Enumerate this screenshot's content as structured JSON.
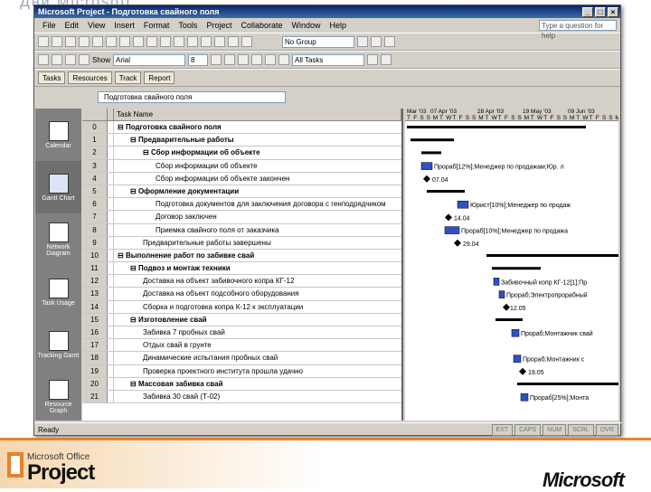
{
  "slide_title": "Дни Microsoft",
  "window": {
    "title": "Microsoft Project - Подготовка свайного поля",
    "min": "_",
    "max": "□",
    "close": "×"
  },
  "menu": [
    "File",
    "Edit",
    "View",
    "Insert",
    "Format",
    "Tools",
    "Project",
    "Collaborate",
    "Window",
    "Help"
  ],
  "ask_placeholder": "Type a question for help",
  "toolbar1": {
    "group_combo": "No Group"
  },
  "toolbar2": {
    "show_label": "Show",
    "font": "Arial",
    "size": "8",
    "filter": "All Tasks"
  },
  "toolbar3": [
    "Tasks",
    "Resources",
    "Track",
    "Report"
  ],
  "entry_value": "Подготовка свайного поля",
  "viewbar": [
    "Calendar",
    "Gantt Chart",
    "Network Diagram",
    "Task Usage",
    "Tracking Gantt",
    "Resource Graph"
  ],
  "grid": {
    "header_name": "Task Name",
    "rows": [
      {
        "id": "0",
        "name": "Подготовка свайного поля",
        "level": 0,
        "summary": true
      },
      {
        "id": "1",
        "name": "Предварительные работы",
        "level": 1,
        "summary": true
      },
      {
        "id": "2",
        "name": "Сбор информации об объекте",
        "level": 2,
        "summary": true
      },
      {
        "id": "3",
        "name": "Сбор информации об объекте",
        "level": 3,
        "summary": false
      },
      {
        "id": "4",
        "name": "Сбор информации об объекте закончен",
        "level": 3,
        "summary": false
      },
      {
        "id": "5",
        "name": "Оформление документации",
        "level": 1,
        "summary": true
      },
      {
        "id": "6",
        "name": "Подготовка документов для заключения договора с генподрядчиком",
        "level": 3,
        "summary": false
      },
      {
        "id": "7",
        "name": "Договор заключен",
        "level": 3,
        "summary": false
      },
      {
        "id": "8",
        "name": "Приемка свайного поля от заказчика",
        "level": 3,
        "summary": false
      },
      {
        "id": "9",
        "name": "Предварительные работы завершены",
        "level": 2,
        "summary": false
      },
      {
        "id": "10",
        "name": "Выполнение работ по забивке свай",
        "level": 0,
        "summary": true
      },
      {
        "id": "11",
        "name": "Подвоз и монтаж техники",
        "level": 1,
        "summary": true
      },
      {
        "id": "12",
        "name": "Доставка на объект забивочного копра КГ-12",
        "level": 2,
        "summary": false
      },
      {
        "id": "13",
        "name": "Доставка на объект подсобного оборудования",
        "level": 2,
        "summary": false
      },
      {
        "id": "14",
        "name": "Сборка и подготовка копра К-12 к эксплуатации",
        "level": 2,
        "summary": false
      },
      {
        "id": "15",
        "name": "Изготовление свай",
        "level": 1,
        "summary": true
      },
      {
        "id": "16",
        "name": "Забивка 7 пробных свай",
        "level": 2,
        "summary": false
      },
      {
        "id": "17",
        "name": "Отдых свай в грунте",
        "level": 2,
        "summary": false
      },
      {
        "id": "18",
        "name": "Динамические испытания пробных свай",
        "level": 2,
        "summary": false
      },
      {
        "id": "19",
        "name": "Проверка проектного института прошла удачно",
        "level": 2,
        "summary": false
      },
      {
        "id": "20",
        "name": "Массовая забивка свай",
        "level": 1,
        "summary": true
      },
      {
        "id": "21",
        "name": "Забивка 30 свай (Т-02)",
        "level": 2,
        "summary": false
      }
    ]
  },
  "gantt": {
    "weeks": [
      "Mar '03",
      "07 Apr '03",
      "28 Apr '03",
      "19 May '03",
      "09 Jun '03"
    ],
    "days": "T F S S M T W T F S S M T W T F S S M T W T F S S M T W T F S S M T W",
    "labels": [
      {
        "row": 3,
        "text": "Прораб[12%];Менеджер по продажам;Юр. л"
      },
      {
        "row": 4,
        "text": "07.04"
      },
      {
        "row": 6,
        "text": "Юрист[10%];Менеджер по продаж"
      },
      {
        "row": 7,
        "text": "14.04"
      },
      {
        "row": 8,
        "text": "Прораб[10%];Менеджер по продажа"
      },
      {
        "row": 9,
        "text": "29.04"
      },
      {
        "row": 12,
        "text": "Забивочный копр КГ-12[1];Пр"
      },
      {
        "row": 13,
        "text": "Прораб;Электропрорабный"
      },
      {
        "row": 14,
        "text": "12.05"
      },
      {
        "row": 16,
        "text": "Прораб;Монтажник свай"
      },
      {
        "row": 18,
        "text": "Прораб;Монтажник с"
      },
      {
        "row": 19,
        "text": "19.05"
      },
      {
        "row": 21,
        "text": "Прораб[25%];Монта"
      }
    ]
  },
  "status": {
    "ready": "Ready",
    "ext": "EXT",
    "caps": "CAPS",
    "num": "NUM",
    "scrl": "SCRL",
    "ovr": "OVR"
  },
  "branding": {
    "office": "Microsoft Office",
    "project": "Project",
    "microsoft": "Microsoft"
  }
}
